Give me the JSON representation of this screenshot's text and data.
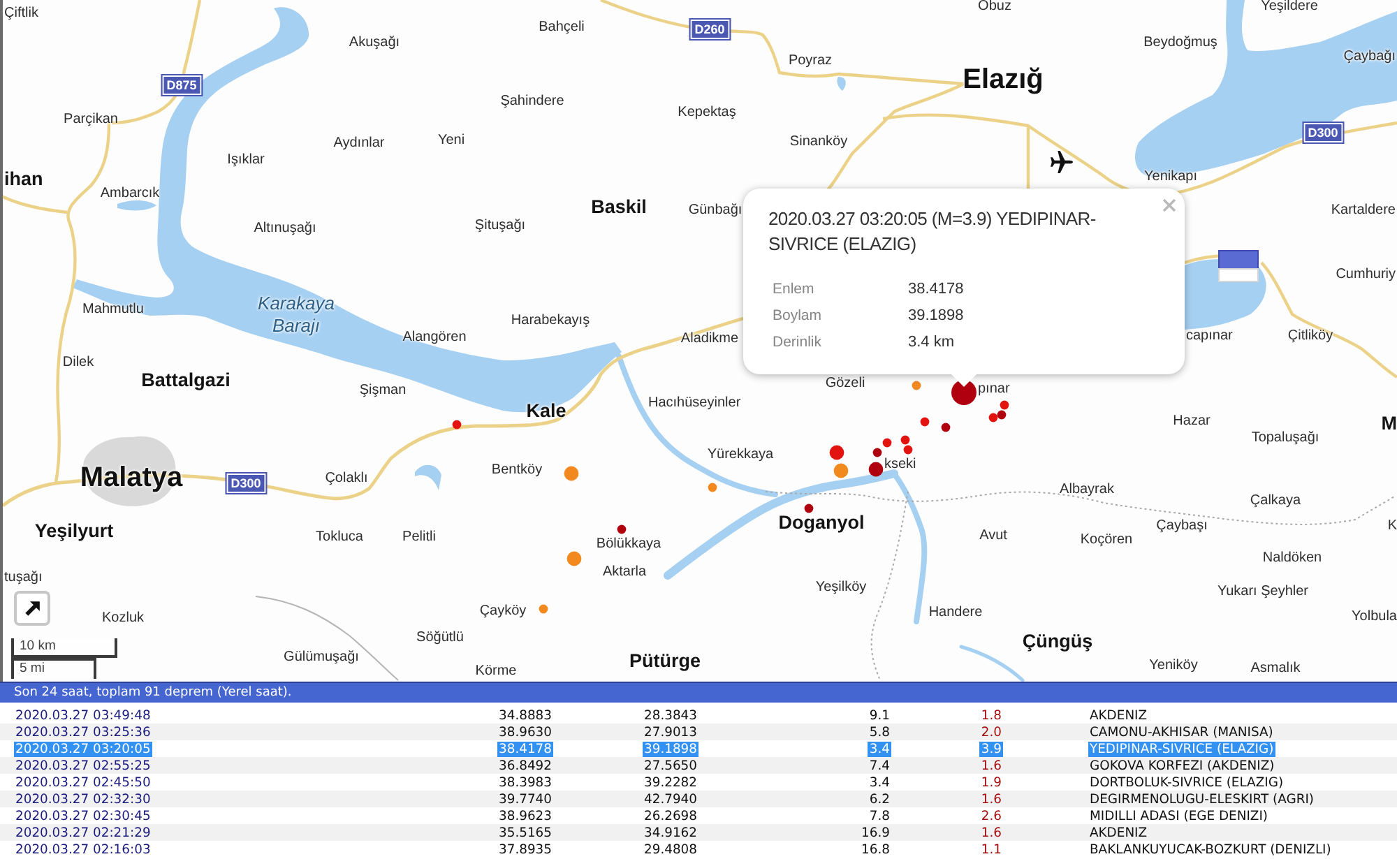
{
  "map": {
    "places": [
      {
        "name": "Çiftlik",
        "kind": "village"
      },
      {
        "name": "Obuz",
        "kind": "village"
      },
      {
        "name": "Yeşildere",
        "kind": "village"
      },
      {
        "name": "Bahçeli",
        "kind": "village"
      },
      {
        "name": "Akuşağı",
        "kind": "village"
      },
      {
        "name": "Beydoğmuş",
        "kind": "village"
      },
      {
        "name": "Poyraz",
        "kind": "village"
      },
      {
        "name": "Çaybağı",
        "kind": "village"
      },
      {
        "name": "Elazığ",
        "kind": "city"
      },
      {
        "name": "Şahindere",
        "kind": "village"
      },
      {
        "name": "Parçikan",
        "kind": "village"
      },
      {
        "name": "Kepektaş",
        "kind": "village"
      },
      {
        "name": "Aydınlar",
        "kind": "village"
      },
      {
        "name": "Yeni",
        "kind": "village"
      },
      {
        "name": "Sinanköy",
        "kind": "village"
      },
      {
        "name": "Işıklar",
        "kind": "village"
      },
      {
        "name": "ihan",
        "kind": "town"
      },
      {
        "name": "Yenikapı",
        "kind": "village"
      },
      {
        "name": "Ambarcık",
        "kind": "village"
      },
      {
        "name": "Baskil",
        "kind": "town"
      },
      {
        "name": "Günbağı",
        "kind": "village"
      },
      {
        "name": "Kartaldere",
        "kind": "village"
      },
      {
        "name": "Altınuşağı",
        "kind": "village"
      },
      {
        "name": "Şituşağı",
        "kind": "village"
      },
      {
        "name": "Cumhuriy",
        "kind": "village"
      },
      {
        "name": "Mahmutlu",
        "kind": "village"
      },
      {
        "name": "Karakaya Barajı",
        "kind": "water"
      },
      {
        "name": "Harabekayış",
        "kind": "village"
      },
      {
        "name": "Alangören",
        "kind": "village"
      },
      {
        "name": "Aladikme",
        "kind": "village"
      },
      {
        "name": "capınar",
        "kind": "village"
      },
      {
        "name": "Çitliköy",
        "kind": "village"
      },
      {
        "name": "Dilek",
        "kind": "village"
      },
      {
        "name": "Battalgazi",
        "kind": "town"
      },
      {
        "name": "Şişman",
        "kind": "village"
      },
      {
        "name": "Gözeli",
        "kind": "village"
      },
      {
        "name": "pınar",
        "kind": "village"
      },
      {
        "name": "Kale",
        "kind": "town"
      },
      {
        "name": "Hacıhüseyinler",
        "kind": "village"
      },
      {
        "name": "Hazar",
        "kind": "village"
      },
      {
        "name": "M",
        "kind": "town"
      },
      {
        "name": "Topaluşağı",
        "kind": "village"
      },
      {
        "name": "Yürekkaya",
        "kind": "village"
      },
      {
        "name": "Malatya",
        "kind": "city"
      },
      {
        "name": "Çolaklı",
        "kind": "village"
      },
      {
        "name": "Bentköy",
        "kind": "village"
      },
      {
        "name": "kseki",
        "kind": "village"
      },
      {
        "name": "Albayrak",
        "kind": "village"
      },
      {
        "name": "Çalkaya",
        "kind": "village"
      },
      {
        "name": "Yeşilyurt",
        "kind": "town"
      },
      {
        "name": "Tokluca",
        "kind": "village"
      },
      {
        "name": "Pelitli",
        "kind": "village"
      },
      {
        "name": "Doganyol",
        "kind": "town"
      },
      {
        "name": "Bölükkaya",
        "kind": "village"
      },
      {
        "name": "Avut",
        "kind": "village"
      },
      {
        "name": "Koçören",
        "kind": "village"
      },
      {
        "name": "Çaybaşı",
        "kind": "village"
      },
      {
        "name": "K",
        "kind": "village"
      },
      {
        "name": "Naldöken",
        "kind": "village"
      },
      {
        "name": "tuşağı",
        "kind": "village"
      },
      {
        "name": "Aktarla",
        "kind": "village"
      },
      {
        "name": "Yeşilköy",
        "kind": "village"
      },
      {
        "name": "Yukarı Şeyhler",
        "kind": "village"
      },
      {
        "name": "Kozluk",
        "kind": "village"
      },
      {
        "name": "Çayköy",
        "kind": "village"
      },
      {
        "name": "Handere",
        "kind": "village"
      },
      {
        "name": "Yolbula",
        "kind": "village"
      },
      {
        "name": "Söğütlü",
        "kind": "village"
      },
      {
        "name": "Çüngüş",
        "kind": "town"
      },
      {
        "name": "Gülümuşağı",
        "kind": "village"
      },
      {
        "name": "Körme",
        "kind": "village"
      },
      {
        "name": "Pütürge",
        "kind": "town"
      },
      {
        "name": "Yeniköy",
        "kind": "village"
      },
      {
        "name": "Asmalık",
        "kind": "village"
      }
    ],
    "road_shields": [
      {
        "label": "D260"
      },
      {
        "label": "D875"
      },
      {
        "label": "D300"
      },
      {
        "label": "D300"
      }
    ],
    "quakes": [
      {
        "color": "#f2891f",
        "kind": "small"
      },
      {
        "color": "#b00010",
        "kind": "large"
      },
      {
        "color": "#e3140f",
        "kind": "small"
      },
      {
        "color": "#e3140f",
        "kind": "small"
      },
      {
        "color": "#e3140f",
        "kind": "small"
      },
      {
        "color": "#b00010",
        "kind": "small"
      },
      {
        "color": "#e3140f",
        "kind": "small"
      },
      {
        "color": "#b00010",
        "kind": "small"
      },
      {
        "color": "#e3140f",
        "kind": "medium"
      },
      {
        "color": "#b00010",
        "kind": "small"
      },
      {
        "color": "#e3140f",
        "kind": "small"
      },
      {
        "color": "#e3140f",
        "kind": "small"
      },
      {
        "color": "#e3140f",
        "kind": "small"
      },
      {
        "color": "#f2891f",
        "kind": "medium"
      },
      {
        "color": "#f2891f",
        "kind": "medium"
      },
      {
        "color": "#b00010",
        "kind": "medium"
      },
      {
        "color": "#f2891f",
        "kind": "small"
      },
      {
        "color": "#b00010",
        "kind": "small"
      },
      {
        "color": "#b00010",
        "kind": "small"
      },
      {
        "color": "#f2891f",
        "kind": "medium"
      },
      {
        "color": "#f2891f",
        "kind": "small"
      }
    ],
    "popup": {
      "title": "2020.03.27 03:20:05 (M=3.9) YEDIPINAR-SIVRICE (ELAZIG)",
      "fields": [
        {
          "label": "Enlem",
          "value": "38.4178"
        },
        {
          "label": "Boylam",
          "value": "39.1898"
        },
        {
          "label": "Derinlik",
          "value": "3.4 km"
        }
      ]
    },
    "scale": {
      "metric": "10 km",
      "imperial": "5 mi"
    }
  },
  "quake_list": {
    "header": "Son 24 saat, toplam 91 deprem (Yerel saat).",
    "rows": [
      {
        "cells": [
          "2020.03.27 03:49:48",
          "34.8883",
          "28.3843",
          "9.1",
          "1.8",
          "AKDENIZ"
        ],
        "selected": false
      },
      {
        "cells": [
          "2020.03.27 03:25:36",
          "38.9630",
          "27.9013",
          "5.8",
          "2.0",
          "CAMONU-AKHISAR (MANISA)"
        ],
        "selected": false
      },
      {
        "cells": [
          "2020.03.27 03:20:05",
          "38.4178",
          "39.1898",
          "3.4",
          "3.9",
          "YEDIPINAR-SIVRICE (ELAZIG)"
        ],
        "selected": true
      },
      {
        "cells": [
          "2020.03.27 02:55:25",
          "36.8492",
          "27.5650",
          "7.4",
          "1.6",
          "GOKOVA KORFEZI (AKDENIZ)"
        ],
        "selected": false
      },
      {
        "cells": [
          "2020.03.27 02:45:50",
          "38.3983",
          "39.2282",
          "3.4",
          "1.9",
          "DORTBOLUK-SIVRICE (ELAZIG)"
        ],
        "selected": false
      },
      {
        "cells": [
          "2020.03.27 02:32:30",
          "39.7740",
          "42.7940",
          "6.2",
          "1.6",
          "DEGIRMENOLUGU-ELESKIRT (AGRI)"
        ],
        "selected": false
      },
      {
        "cells": [
          "2020.03.27 02:30:45",
          "38.9623",
          "26.2698",
          "7.8",
          "2.6",
          "MIDILLI ADASI (EGE DENIZI)"
        ],
        "selected": false
      },
      {
        "cells": [
          "2020.03.27 02:21:29",
          "35.5165",
          "34.9162",
          "16.9",
          "1.6",
          "AKDENIZ"
        ],
        "selected": false
      },
      {
        "cells": [
          "2020.03.27 02:16:03",
          "37.8935",
          "29.4808",
          "16.8",
          "1.1",
          "BAKLANKUYUCAK-BOZKURT (DENIZLI)"
        ],
        "selected": false
      }
    ]
  }
}
